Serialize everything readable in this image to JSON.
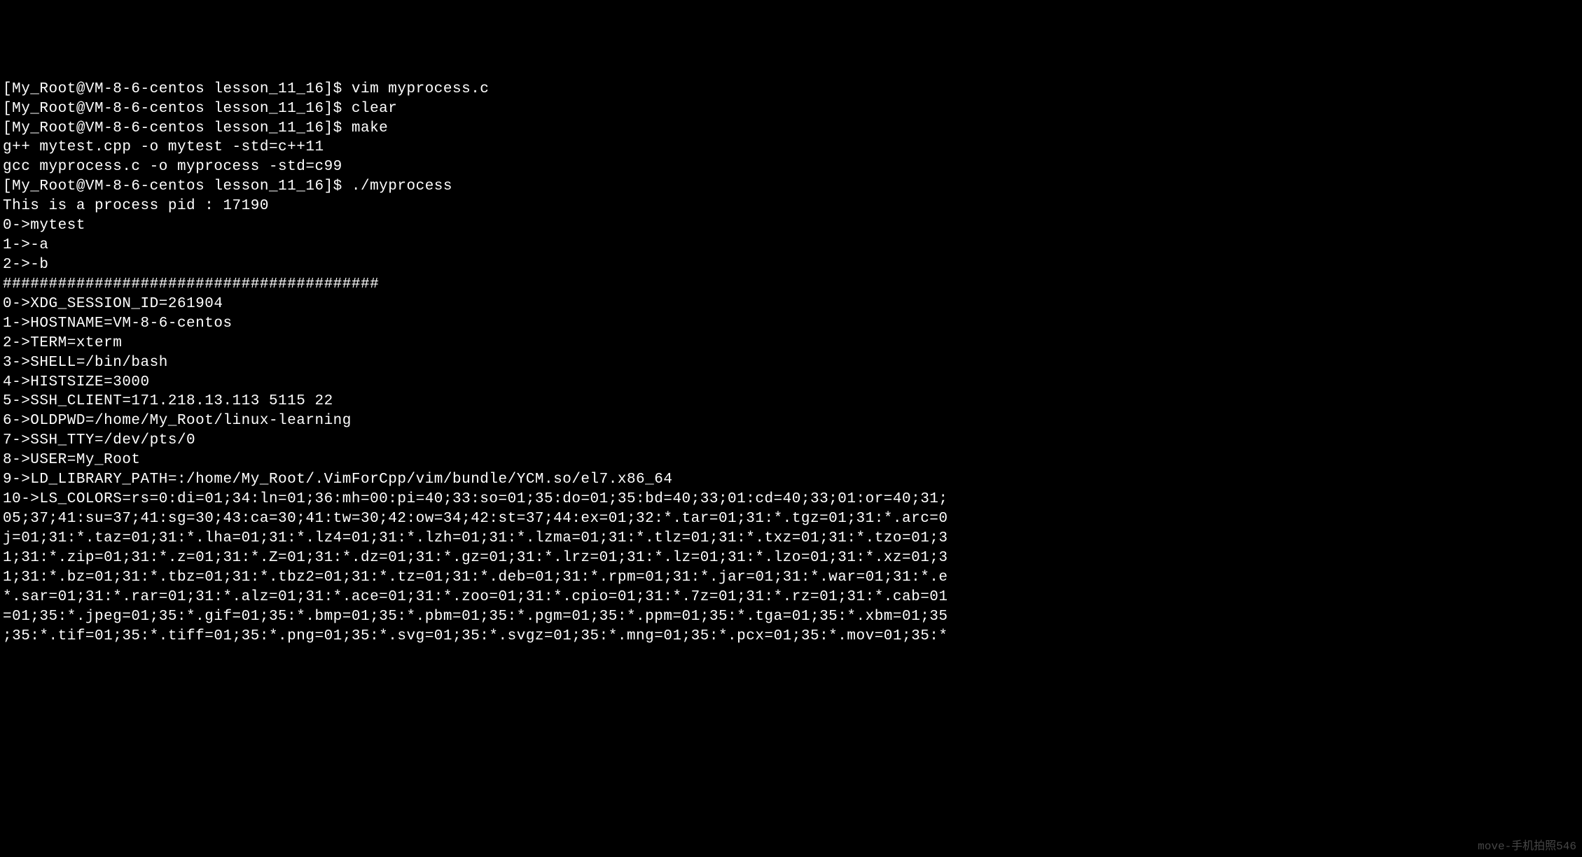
{
  "terminal": {
    "lines": [
      "[My_Root@VM-8-6-centos lesson_11_16]$ vim myprocess.c",
      "[My_Root@VM-8-6-centos lesson_11_16]$ clear",
      "[My_Root@VM-8-6-centos lesson_11_16]$ make",
      "g++ mytest.cpp -o mytest -std=c++11",
      "gcc myprocess.c -o myprocess -std=c99",
      "[My_Root@VM-8-6-centos lesson_11_16]$ ./myprocess",
      "This is a process pid : 17190",
      "0->mytest",
      "1->-a",
      "2->-b",
      "#########################################",
      "0->XDG_SESSION_ID=261904",
      "1->HOSTNAME=VM-8-6-centos",
      "2->TERM=xterm",
      "3->SHELL=/bin/bash",
      "4->HISTSIZE=3000",
      "5->SSH_CLIENT=171.218.13.113 5115 22",
      "6->OLDPWD=/home/My_Root/linux-learning",
      "7->SSH_TTY=/dev/pts/0",
      "8->USER=My_Root",
      "9->LD_LIBRARY_PATH=:/home/My_Root/.VimForCpp/vim/bundle/YCM.so/el7.x86_64",
      "10->LS_COLORS=rs=0:di=01;34:ln=01;36:mh=00:pi=40;33:so=01;35:do=01;35:bd=40;33;01:cd=40;33;01:or=40;31;",
      "05;37;41:su=37;41:sg=30;43:ca=30;41:tw=30;42:ow=34;42:st=37;44:ex=01;32:*.tar=01;31:*.tgz=01;31:*.arc=0",
      "j=01;31:*.taz=01;31:*.lha=01;31:*.lz4=01;31:*.lzh=01;31:*.lzma=01;31:*.tlz=01;31:*.txz=01;31:*.tzo=01;3",
      "1;31:*.zip=01;31:*.z=01;31:*.Z=01;31:*.dz=01;31:*.gz=01;31:*.lrz=01;31:*.lz=01;31:*.lzo=01;31:*.xz=01;3",
      "1;31:*.bz=01;31:*.tbz=01;31:*.tbz2=01;31:*.tz=01;31:*.deb=01;31:*.rpm=01;31:*.jar=01;31:*.war=01;31:*.e",
      "*.sar=01;31:*.rar=01;31:*.alz=01;31:*.ace=01;31:*.zoo=01;31:*.cpio=01;31:*.7z=01;31:*.rz=01;31:*.cab=01",
      "=01;35:*.jpeg=01;35:*.gif=01;35:*.bmp=01;35:*.pbm=01;35:*.pgm=01;35:*.ppm=01;35:*.tga=01;35:*.xbm=01;35",
      ";35:*.tif=01;35:*.tiff=01;35:*.png=01;35:*.svg=01;35:*.svgz=01;35:*.mng=01;35:*.pcx=01;35:*.mov=01;35:*"
    ]
  },
  "watermark": "move-手机拍照546"
}
